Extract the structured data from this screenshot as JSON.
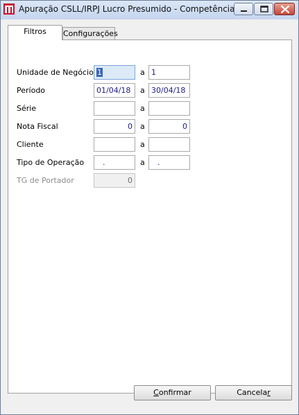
{
  "window": {
    "title": "Apuração CSLL/IRPJ Lucro Presumido - Competência",
    "icons": {
      "app": "app-logo-icon",
      "minimize": "minimize-icon",
      "maximize": "maximize-icon",
      "close": "close-icon"
    }
  },
  "tabs": [
    {
      "label": "Filtros",
      "active": true
    },
    {
      "label": "Configurações",
      "active": false
    }
  ],
  "form": {
    "separator": "a",
    "rows": [
      {
        "label": "Unidade de Negócio",
        "from": "1",
        "to": "1"
      },
      {
        "label": "Período",
        "from": "01/04/18",
        "to": "30/04/18"
      },
      {
        "label": "Série",
        "from": "",
        "to": ""
      },
      {
        "label": "Nota Fiscal",
        "from": "0",
        "to": "0"
      },
      {
        "label": "Cliente",
        "from": "",
        "to": ""
      },
      {
        "label": "Tipo de Operação",
        "from": ".",
        "to": "."
      },
      {
        "label": "TG de Portador",
        "value": "0",
        "disabled": true
      }
    ]
  },
  "buttons": {
    "confirm": {
      "first": "C",
      "rest": "onfirmar"
    },
    "cancel": {
      "first": "Cancela",
      "underlined": "r"
    }
  }
}
